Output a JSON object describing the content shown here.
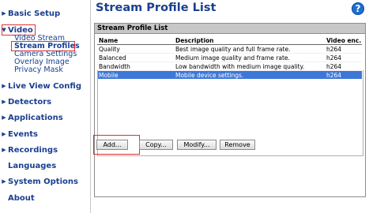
{
  "sidebar": {
    "items": [
      {
        "label": "Basic Setup",
        "arrow": "▶"
      },
      {
        "label": "Video",
        "arrow": "▼"
      },
      {
        "label": "Live View Config",
        "arrow": "▶"
      },
      {
        "label": "Detectors",
        "arrow": "▶"
      },
      {
        "label": "Applications",
        "arrow": "▶"
      },
      {
        "label": "Events",
        "arrow": "▶"
      },
      {
        "label": "Recordings",
        "arrow": "▶"
      },
      {
        "label": "Languages",
        "arrow": ""
      },
      {
        "label": "System Options",
        "arrow": "▶"
      },
      {
        "label": "About",
        "arrow": ""
      }
    ],
    "video_sub": [
      "Video Stream",
      "Stream Profiles",
      "Camera Settings",
      "Overlay Image",
      "Privacy Mask"
    ]
  },
  "main": {
    "title": "Stream Profile List",
    "help": "?",
    "panel_title": "Stream Profile List",
    "columns": [
      "Name",
      "Description",
      "Video enc."
    ],
    "rows": [
      {
        "name": "Quality",
        "description": "Best image quality and full frame rate.",
        "enc": "h264"
      },
      {
        "name": "Balanced",
        "description": "Medium image quality and frame rate.",
        "enc": "h264"
      },
      {
        "name": "Bandwidth",
        "description": "Low bandwidth with medium image quality.",
        "enc": "h264"
      },
      {
        "name": "Mobile",
        "description": "Mobile device settings.",
        "enc": "h264"
      }
    ],
    "buttons": {
      "add": "Add...",
      "copy": "Copy...",
      "modify": "Modify...",
      "remove": "Remove"
    }
  },
  "colors": {
    "nav": "#1a3f8f",
    "selected_row": "#3d77d8",
    "highlight": "#e03030"
  }
}
